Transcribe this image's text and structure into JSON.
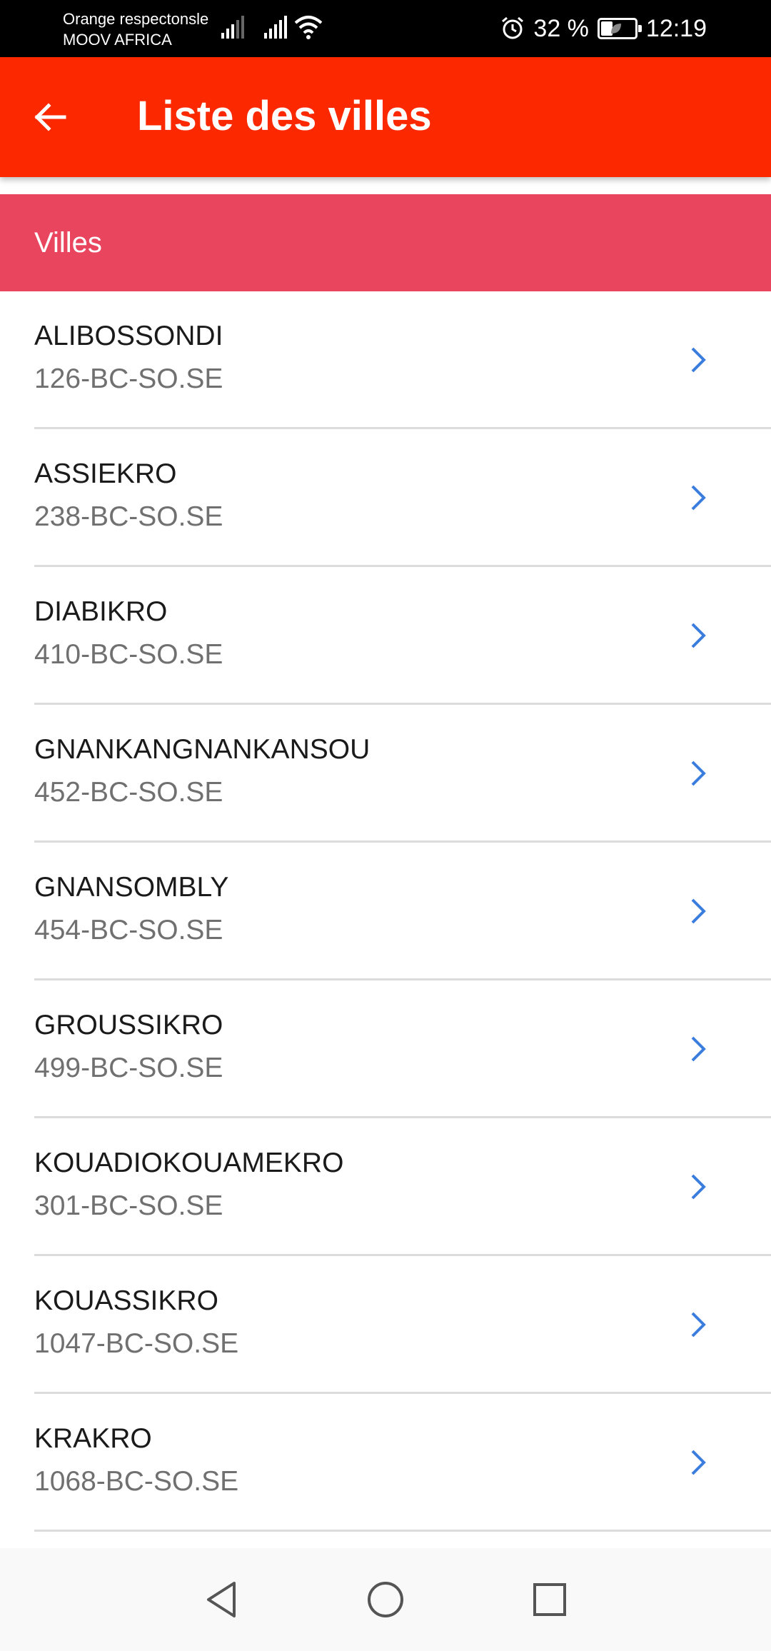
{
  "status_bar": {
    "carrier_line1": "Orange respectonsle",
    "carrier_line2": "MOOV AFRICA",
    "battery_percent": "32 %",
    "battery_level": 0.32,
    "time": "12:19",
    "icons": [
      "signal-icon",
      "signal-icon",
      "wifi-icon",
      "alarm-icon",
      "battery-icon"
    ]
  },
  "app_bar": {
    "back_icon": "arrow-back-icon",
    "title": "Liste des villes",
    "color": "#fc2800"
  },
  "section": {
    "header": "Villes",
    "color": "#e9455e"
  },
  "list": {
    "items": [
      {
        "name": "ALIBOSSONDI",
        "code": "126-BC-SO.SE"
      },
      {
        "name": "ASSIEKRO",
        "code": "238-BC-SO.SE"
      },
      {
        "name": "DIABIKRO",
        "code": "410-BC-SO.SE"
      },
      {
        "name": "GNANKANGNANKANSOU",
        "code": "452-BC-SO.SE"
      },
      {
        "name": "GNANSOMBLY",
        "code": "454-BC-SO.SE"
      },
      {
        "name": "GROUSSIKRO",
        "code": "499-BC-SO.SE"
      },
      {
        "name": "KOUADIOKOUAMEKRO",
        "code": "301-BC-SO.SE"
      },
      {
        "name": "KOUASSIKRO",
        "code": "1047-BC-SO.SE"
      },
      {
        "name": "KRAKRO",
        "code": "1068-BC-SO.SE"
      }
    ],
    "chevron_icon": "chevron-right-icon",
    "chevron_color": "#3b7ddd"
  },
  "nav_bar": {
    "icons": [
      "nav-back-icon",
      "nav-home-icon",
      "nav-recent-icon"
    ]
  }
}
